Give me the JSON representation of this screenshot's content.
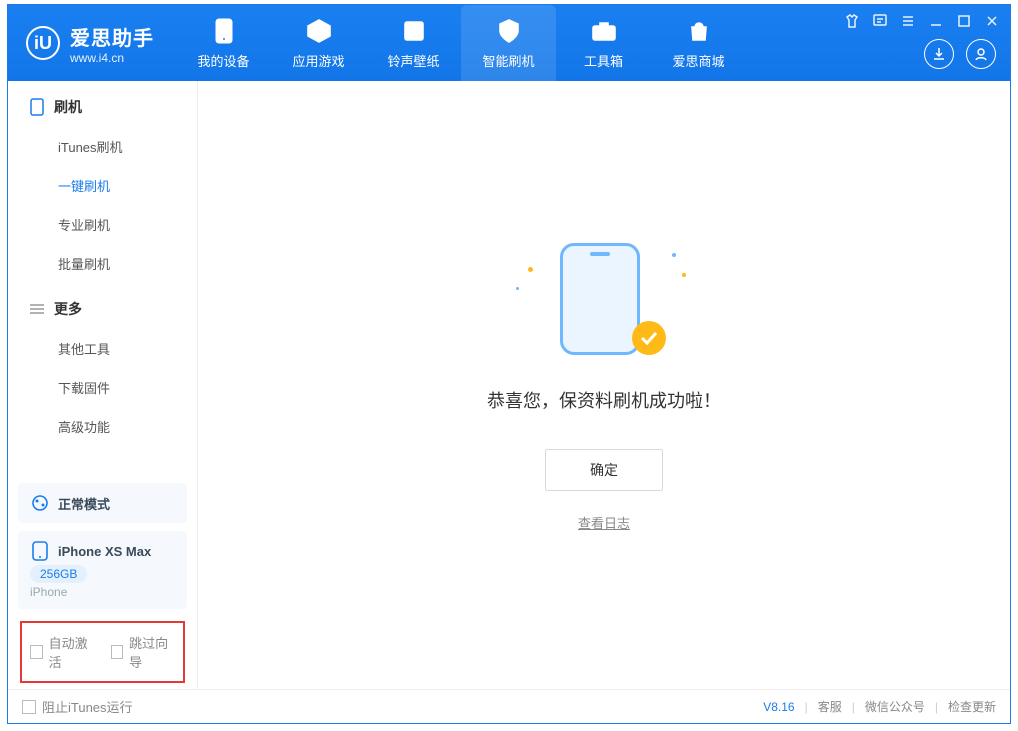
{
  "app": {
    "name": "爱思助手",
    "url": "www.i4.cn"
  },
  "nav": {
    "device": "我的设备",
    "apps": "应用游戏",
    "ringtone": "铃声壁纸",
    "flash": "智能刷机",
    "toolbox": "工具箱",
    "store": "爱思商城"
  },
  "sidebar": {
    "group_flash": "刷机",
    "itunes_flash": "iTunes刷机",
    "one_click_flash": "一键刷机",
    "pro_flash": "专业刷机",
    "batch_flash": "批量刷机",
    "group_more": "更多",
    "other_tools": "其他工具",
    "download_firmware": "下载固件",
    "advanced": "高级功能"
  },
  "mode_card": {
    "label": "正常模式"
  },
  "device_card": {
    "name": "iPhone XS Max",
    "storage": "256GB",
    "sub": "iPhone"
  },
  "options": {
    "auto_activate": "自动激活",
    "skip_guide": "跳过向导"
  },
  "main": {
    "title": "恭喜您，保资料刷机成功啦！",
    "confirm": "确定",
    "view_log": "查看日志"
  },
  "footer": {
    "block_itunes": "阻止iTunes运行",
    "version": "V8.16",
    "customer_service": "客服",
    "wechat": "微信公众号",
    "check_update": "检查更新"
  }
}
